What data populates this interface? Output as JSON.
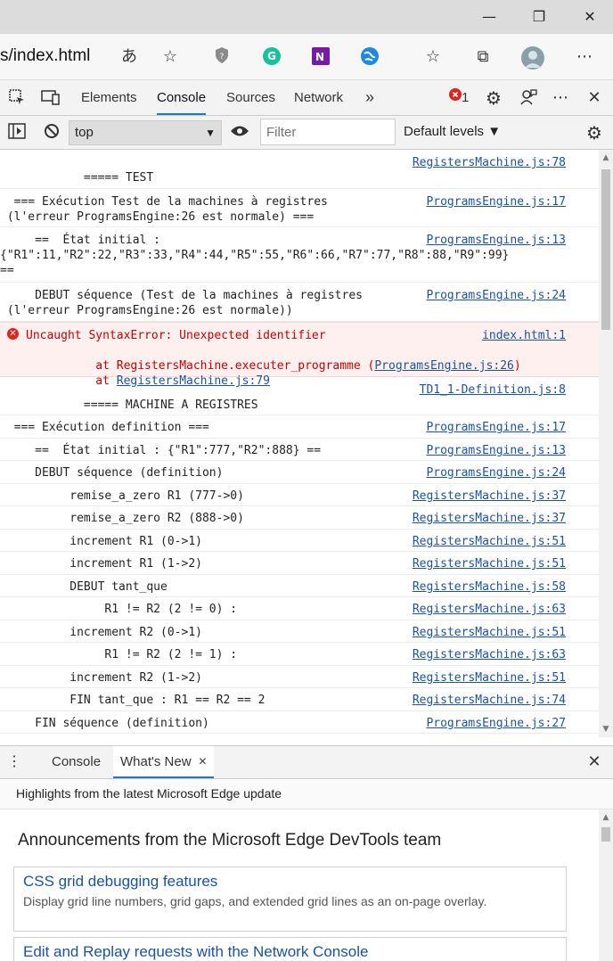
{
  "window": {
    "minimize": "—",
    "maximize": "❐",
    "close": "✕"
  },
  "address": {
    "url": "s/index.html"
  },
  "devtools": {
    "tabs": [
      "Elements",
      "Console",
      "Sources",
      "Network"
    ],
    "more": "»",
    "error_count": "1"
  },
  "console_toolbar": {
    "context": "top",
    "filter_placeholder": "Filter",
    "levels": "Default levels ▼"
  },
  "messages": [
    {
      "text": "            ===== TEST",
      "src": "RegistersMachine.js:78"
    },
    {
      "text": "  === Exécution Test de la machines à registres\n (l'erreur ProgramsEngine:26 est normale) ===",
      "src": "ProgramsEngine.js:17"
    },
    {
      "text": "     ==  État initial :\n{\"R1\":11,\"R2\":22,\"R3\":33,\"R4\":44,\"R5\":55,\"R6\":66,\"R7\":77,\"R8\":88,\"R9\":99}\n==",
      "src": "ProgramsEngine.js:13"
    },
    {
      "text": "     DEBUT séquence (Test de la machines à registres\n (l'erreur ProgramsEngine:26 est normale))",
      "src": "ProgramsEngine.js:24"
    },
    {
      "text": "            ===== MACHINE A REGISTRES",
      "src": "TD1_1-Definition.js:8"
    },
    {
      "text": "  === Exécution definition ===",
      "src": "ProgramsEngine.js:17"
    },
    {
      "text": "     ==  État initial : {\"R1\":777,\"R2\":888} ==",
      "src": "ProgramsEngine.js:13"
    },
    {
      "text": "     DEBUT séquence (definition)",
      "src": "ProgramsEngine.js:24"
    },
    {
      "text": "          remise_a_zero R1 (777->0)",
      "src": "RegistersMachine.js:37"
    },
    {
      "text": "          remise_a_zero R2 (888->0)",
      "src": "RegistersMachine.js:37"
    },
    {
      "text": "          increment R1 (0->1)",
      "src": "RegistersMachine.js:51"
    },
    {
      "text": "          increment R1 (1->2)",
      "src": "RegistersMachine.js:51"
    },
    {
      "text": "          DEBUT tant_que",
      "src": "RegistersMachine.js:58"
    },
    {
      "text": "               R1 != R2 (2 != 0) :",
      "src": "RegistersMachine.js:63"
    },
    {
      "text": "          increment R2 (0->1)",
      "src": "RegistersMachine.js:51"
    },
    {
      "text": "               R1 != R2 (2 != 1) :",
      "src": "RegistersMachine.js:63"
    },
    {
      "text": "          increment R2 (1->2)",
      "src": "RegistersMachine.js:51"
    },
    {
      "text": "          FIN tant_que : R1 == R2 == 2",
      "src": "RegistersMachine.js:74"
    },
    {
      "text": "     FIN séquence (definition)",
      "src": "ProgramsEngine.js:27"
    }
  ],
  "error": {
    "message": "Uncaught SyntaxError: Unexpected identifier",
    "src": "index.html:1",
    "stack1_prefix": "    at RegistersMachine.executer_programme (",
    "stack1_link": "ProgramsEngine.js:26",
    "stack1_suffix": ")",
    "stack2_prefix": "    at ",
    "stack2_link": "RegistersMachine.js:79"
  },
  "drawer": {
    "tabs": [
      "Console",
      "What's New"
    ],
    "close_tab": "×",
    "highlight": "Highlights from the latest Microsoft Edge update"
  },
  "whats_new": {
    "title": "Announcements from the Microsoft Edge DevTools team",
    "cards": [
      {
        "title": "CSS grid debugging features",
        "desc": "Display grid line numbers, grid gaps, and extended grid lines as an on-page overlay."
      },
      {
        "title": "Edit and Replay requests with the Network Console",
        "desc": ""
      }
    ]
  },
  "colors": {
    "accent": "#1a73e8",
    "link": "#1a52a6",
    "error": "#c80000",
    "error_bg": "#fff0f0"
  }
}
